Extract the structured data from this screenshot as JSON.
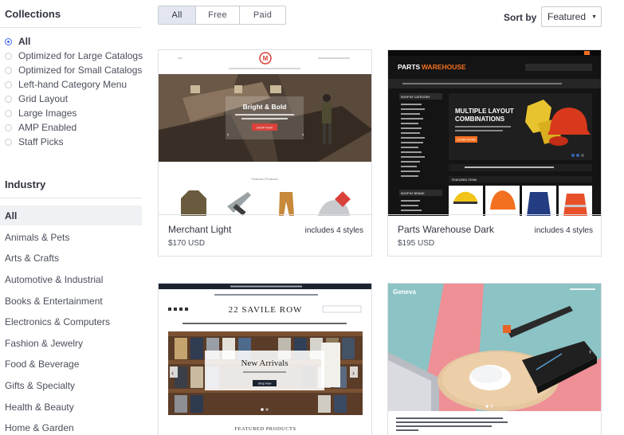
{
  "sidebar": {
    "collections_title": "Collections",
    "collections": [
      {
        "label": "All",
        "selected": true
      },
      {
        "label": "Optimized for Large Catalogs",
        "selected": false
      },
      {
        "label": "Optimized for Small Catalogs",
        "selected": false
      },
      {
        "label": "Left-hand Category Menu",
        "selected": false
      },
      {
        "label": "Grid Layout",
        "selected": false
      },
      {
        "label": "Large Images",
        "selected": false
      },
      {
        "label": "AMP Enabled",
        "selected": false
      },
      {
        "label": "Staff Picks",
        "selected": false
      }
    ],
    "industry_title": "Industry",
    "industries": [
      {
        "label": "All",
        "selected": true
      },
      {
        "label": "Animals & Pets"
      },
      {
        "label": "Arts & Crafts"
      },
      {
        "label": "Automotive & Industrial"
      },
      {
        "label": "Books & Entertainment"
      },
      {
        "label": "Electronics & Computers"
      },
      {
        "label": "Fashion & Jewelry"
      },
      {
        "label": "Food & Beverage"
      },
      {
        "label": "Gifts & Specialty"
      },
      {
        "label": "Health & Beauty"
      },
      {
        "label": "Home & Garden"
      }
    ]
  },
  "filter_tabs": [
    {
      "label": "All",
      "selected": true
    },
    {
      "label": "Free"
    },
    {
      "label": "Paid"
    }
  ],
  "sort": {
    "label": "Sort by",
    "value": "Featured"
  },
  "cards": [
    {
      "name": "Merchant Light",
      "price": "$170 USD",
      "styles": "includes 4 styles",
      "preview": {
        "hero_title": "Bright & Bold",
        "hero_button": "SHOP NOW",
        "section_label": "Featured Products"
      }
    },
    {
      "name": "Parts Warehouse Dark",
      "price": "$195 USD",
      "styles": "includes 4 styles",
      "preview": {
        "logo_part1": "PARTS",
        "logo_part2": "WAREHOUSE",
        "banner_title_1": "MULTIPLE LAYOUT",
        "banner_title_2": "COMBINATIONS",
        "banner_button": "LEARN MORE",
        "sidebar_heading": "SHOP BY CATEGORY",
        "brand_heading": "SHOP BY BRAND",
        "featured_heading": "FEATURED ITEMS"
      }
    },
    {
      "name": "",
      "price": "",
      "styles": "",
      "preview": {
        "logo": "22 SAVILE ROW",
        "hero_title": "New Arrivals",
        "hero_button": "Shop Now",
        "section_label": "FEATURED PRODUCTS"
      }
    },
    {
      "name": "",
      "price": "",
      "styles": "",
      "preview": {
        "logo": "Geneva"
      }
    }
  ],
  "colors": {
    "accent": "#3c64f4",
    "merchant_red": "#d9423a",
    "parts_orange": "#f37021"
  }
}
